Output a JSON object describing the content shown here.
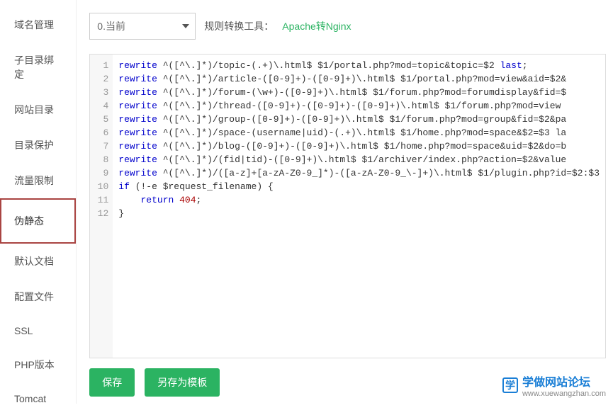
{
  "sidebar": {
    "items": [
      {
        "label": "域名管理"
      },
      {
        "label": "子目录绑定"
      },
      {
        "label": "网站目录"
      },
      {
        "label": "目录保护"
      },
      {
        "label": "流量限制"
      },
      {
        "label": "伪静态",
        "active": true
      },
      {
        "label": "默认文档"
      },
      {
        "label": "配置文件"
      },
      {
        "label": "SSL"
      },
      {
        "label": "PHP版本"
      },
      {
        "label": "Tomcat"
      }
    ]
  },
  "toolbar": {
    "select_value": "0.当前",
    "tool_label": "规则转换工具：",
    "tool_link": "Apache转Nginx"
  },
  "editor": {
    "lines": [
      "rewrite ^([^\\.]*)/topic-(.+)\\.html$ $1/portal.php?mod=topic&topic=$2 last;",
      "rewrite ^([^\\.]*)/article-([0-9]+)-([0-9]+)\\.html$ $1/portal.php?mod=view&aid=$2&",
      "rewrite ^([^\\.]*)/forum-(\\w+)-([0-9]+)\\.html$ $1/forum.php?mod=forumdisplay&fid=$",
      "rewrite ^([^\\.]*)/thread-([0-9]+)-([0-9]+)-([0-9]+)\\.html$ $1/forum.php?mod=view",
      "rewrite ^([^\\.]*)/group-([0-9]+)-([0-9]+)\\.html$ $1/forum.php?mod=group&fid=$2&pa",
      "rewrite ^([^\\.]*)/space-(username|uid)-(.+)\\.html$ $1/home.php?mod=space&$2=$3 la",
      "rewrite ^([^\\.]*)/blog-([0-9]+)-([0-9]+)\\.html$ $1/home.php?mod=space&uid=$2&do=b",
      "rewrite ^([^\\.]*)/(fid|tid)-([0-9]+)\\.html$ $1/archiver/index.php?action=$2&value",
      "rewrite ^([^\\.]*)/([a-z]+[a-zA-Z0-9_]*)-([a-zA-Z0-9_\\-]+)\\.html$ $1/plugin.php?id=$2:$3",
      "if (!-e $request_filename) {",
      "    return 404;",
      "}"
    ]
  },
  "actions": {
    "save_label": "保存",
    "save_as_label": "另存为模板"
  },
  "watermark": {
    "badge": "学",
    "title": "学做网站论坛",
    "url": "www.xuewangzhan.com"
  }
}
